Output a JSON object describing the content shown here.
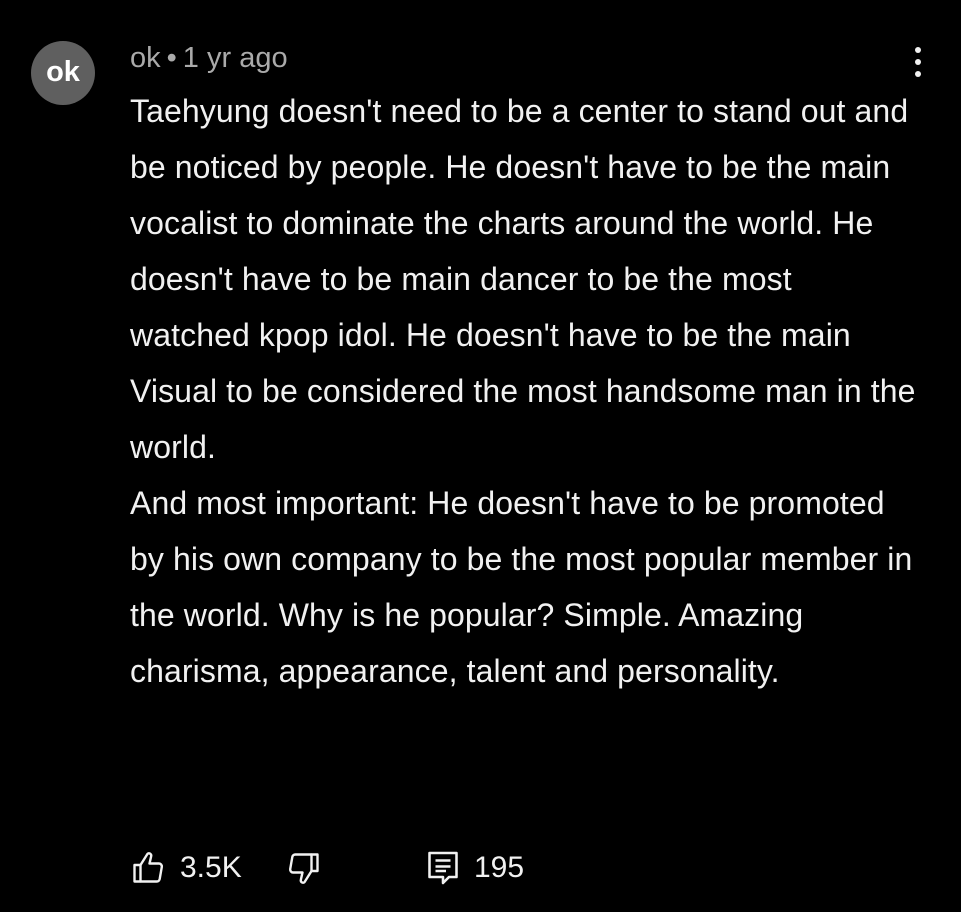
{
  "comment": {
    "avatar_text": "ok",
    "author": "ok",
    "separator": "•",
    "timestamp": "1 yr ago",
    "more_icon": "more-vert-icon",
    "paragraphs": [
      "Taehyung doesn't need to be a center to stand out and be noticed by people. He doesn't have to be the main vocalist to dominate the charts around the world. He doesn't have to be main dancer to be the most watched kpop idol. He doesn't have to be the main Visual to be considered the most handsome man in the world.",
      "And most important: He doesn't have to be promoted by his own company to be the most popular member in the world. Why is he popular? Simple. Amazing charisma, appearance, talent and personality."
    ],
    "like_count": "3.5K",
    "reply_count": "195",
    "icons": {
      "like": "thumbs-up-icon",
      "dislike": "thumbs-down-icon",
      "reply": "reply-comment-icon"
    }
  },
  "colors": {
    "background": "#000000",
    "text": "#f1f1f1",
    "meta_text": "#aaaaaa",
    "avatar_bg": "#5f5f5f"
  }
}
